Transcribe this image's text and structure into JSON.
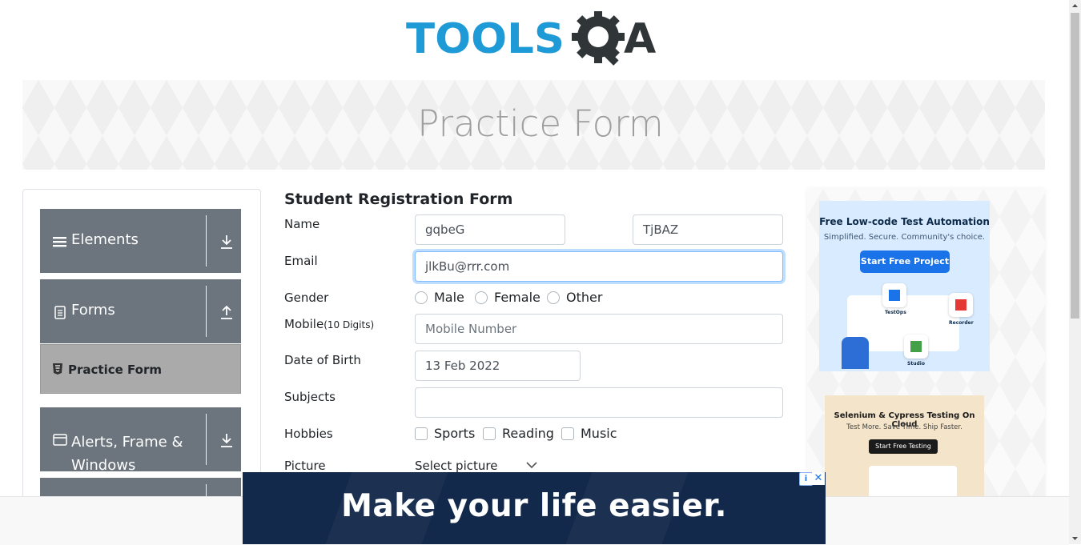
{
  "logo": {
    "text_left": "TOOLS",
    "text_right": "A"
  },
  "banner": {
    "title": "Practice Form"
  },
  "sidebar": {
    "groups": [
      {
        "label": "Elements",
        "icon": "hamburger-icon",
        "arrow": "download-arrow-icon"
      },
      {
        "label": "Forms",
        "icon": "document-icon",
        "arrow": "upload-arrow-icon"
      },
      {
        "label_line1": "Alerts, Frame &",
        "label_line2": "Windows",
        "icon": "window-icon",
        "arrow": "download-arrow-icon"
      }
    ],
    "active_item": {
      "label": "Practice Form",
      "icon": "html5-icon"
    }
  },
  "form": {
    "title": "Student Registration Form",
    "name": {
      "label": "Name",
      "first_value": "gqbeG",
      "last_value": "TjBAZ"
    },
    "email": {
      "label": "Email",
      "value": "jlkBu@rrr.com"
    },
    "gender": {
      "label": "Gender",
      "options": [
        "Male",
        "Female",
        "Other"
      ]
    },
    "mobile": {
      "label": "Mobile",
      "hint": "(10 Digits)",
      "placeholder": "Mobile Number"
    },
    "dob": {
      "label": "Date of Birth",
      "value": "13 Feb 2022"
    },
    "subjects": {
      "label": "Subjects",
      "value": ""
    },
    "hobbies": {
      "label": "Hobbies",
      "options": [
        "Sports",
        "Reading",
        "Music"
      ]
    },
    "picture": {
      "label": "Picture",
      "select_label": "Select picture"
    }
  },
  "ads": {
    "ad1": {
      "title": "Free Low-code Test Automation",
      "subtitle": "Simplified. Secure. Community's choice.",
      "button": "Start Free Project",
      "tiles": [
        "TestOps",
        "Recorder",
        "Studio"
      ]
    },
    "ad2": {
      "title": "Selenium & Cypress Testing On Cloud",
      "subtitle": "Test More. Save Time. Ship Faster.",
      "button": "Start Free Testing"
    },
    "bottom": {
      "text": "Make your life easier.",
      "info": "i",
      "close": "✕"
    }
  },
  "colors": {
    "brand_blue": "#1e9ad6",
    "sidebar_gray": "#6c757d",
    "focus": "#80bdff"
  }
}
